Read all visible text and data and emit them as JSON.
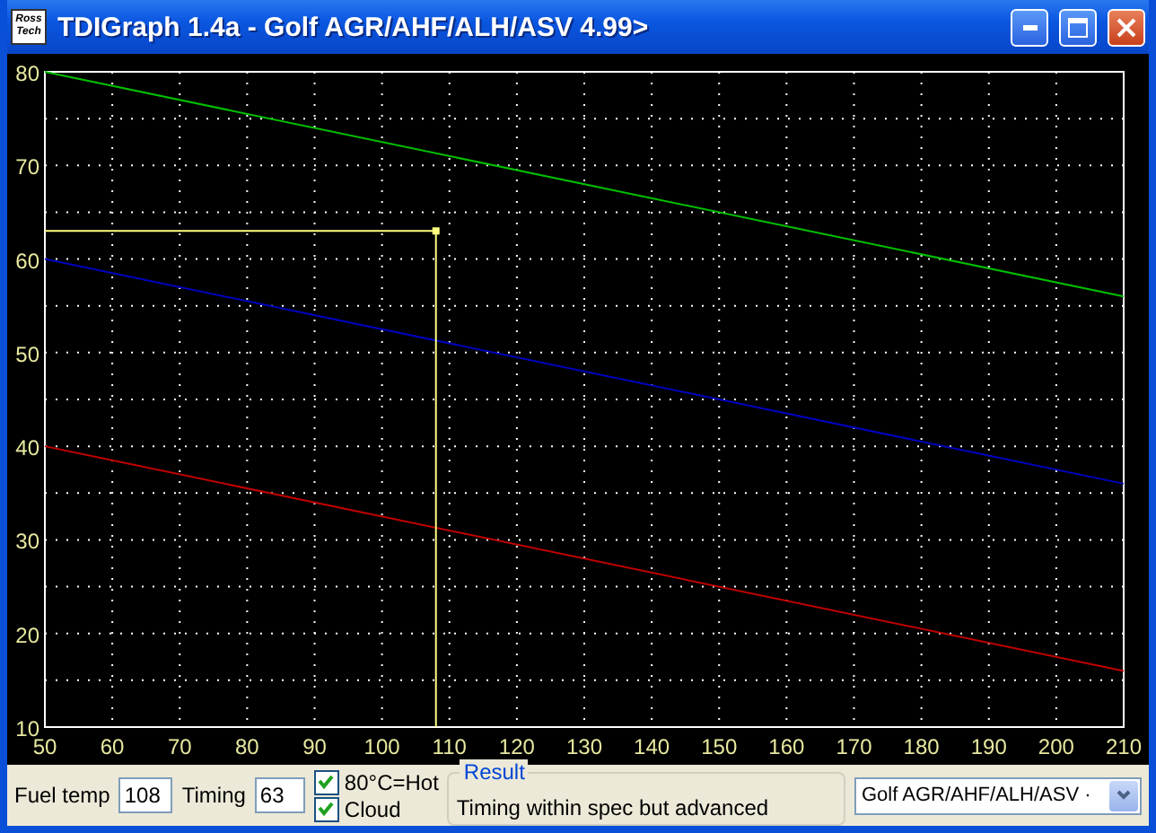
{
  "window": {
    "title": "TDIGraph 1.4a - Golf AGR/AHF/ALH/ASV 4.99>",
    "logo": [
      "Ross",
      "Tech"
    ]
  },
  "chart": {
    "chart_data": {
      "type": "line",
      "x": [
        50,
        210
      ],
      "xlim": [
        50,
        210
      ],
      "ylim": [
        10,
        80
      ],
      "xticks": [
        50,
        60,
        70,
        80,
        90,
        100,
        110,
        120,
        130,
        140,
        150,
        160,
        170,
        180,
        190,
        200,
        210
      ],
      "yticks": [
        10,
        20,
        30,
        40,
        50,
        60,
        70,
        80
      ],
      "series": [
        {
          "color": "#00c000",
          "values": [
            80,
            56
          ]
        },
        {
          "color": "#0000c0",
          "values": [
            60,
            36
          ]
        },
        {
          "color": "#c00000",
          "values": [
            40,
            16
          ]
        }
      ],
      "grid": true,
      "ref_lines": [
        {
          "axis": "x",
          "value": 108
        },
        {
          "axis": "y",
          "value": 63
        }
      ]
    }
  },
  "controls": {
    "fuel_temp": {
      "label": "Fuel temp",
      "value": "108"
    },
    "timing": {
      "label": "Timing",
      "value": "63"
    },
    "checkboxes": [
      {
        "label": "80°C=Hot",
        "checked": true
      },
      {
        "label": "Cloud",
        "checked": true
      }
    ],
    "result": {
      "title": "Result",
      "text": "Timing within spec but advanced"
    },
    "engine_select": {
      "value": "Golf AGR/AHF/ALH/ASV ·"
    }
  }
}
